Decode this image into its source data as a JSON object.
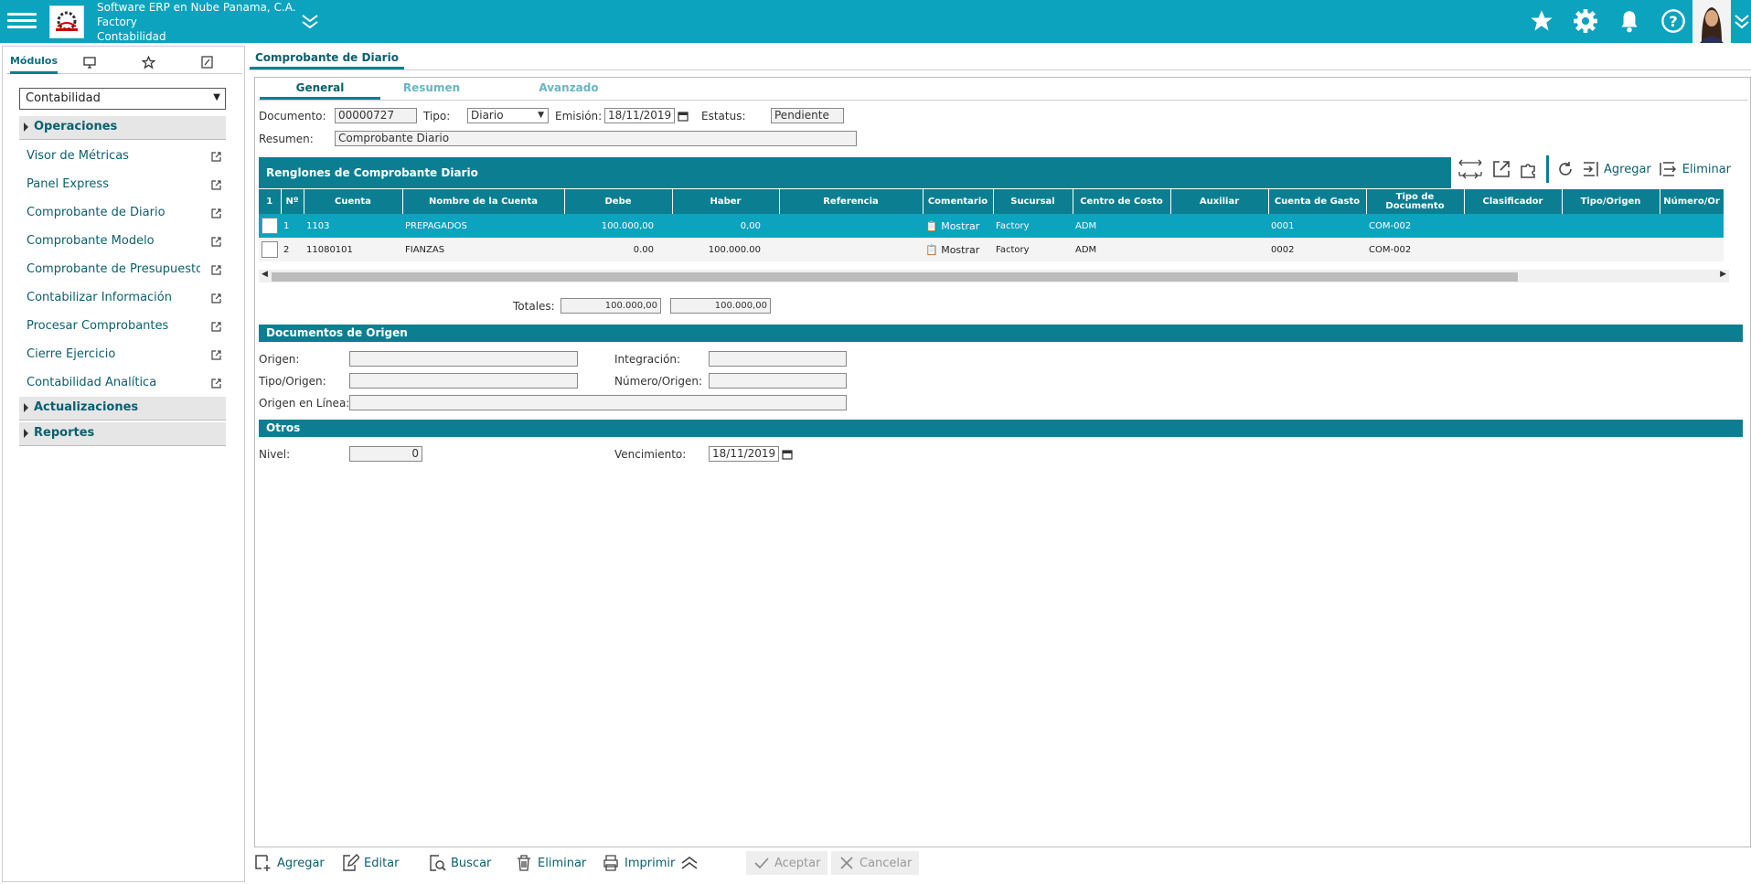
{
  "header": {
    "company": "Software ERP en Nube Panama, C.A.",
    "branch": "Factory",
    "module": "Contabilidad"
  },
  "left": {
    "tab_modules": "Módulos",
    "module_select": "Contabilidad",
    "sections": {
      "operaciones": "Operaciones",
      "actualizaciones": "Actualizaciones",
      "reportes": "Reportes"
    },
    "items": [
      "Visor de Métricas",
      "Panel Express",
      "Comprobante de Diario",
      "Comprobante Modelo",
      "Comprobante de Presupuesto",
      "Contabilizar Información",
      "Procesar Comprobantes",
      "Cierre Ejercicio",
      "Contabilidad Analítica"
    ]
  },
  "main": {
    "tab_title": "Comprobante de Diario",
    "subtabs": [
      "General",
      "Resumen",
      "Avanzado"
    ],
    "form": {
      "documento_label": "Documento:",
      "documento": "00000727",
      "tipo_label": "Tipo:",
      "tipo": "Diario",
      "emision_label": "Emisión:",
      "emision": "18/11/2019",
      "estatus_label": "Estatus:",
      "estatus": "Pendiente",
      "resumen_label": "Resumen:",
      "resumen": "Comprobante Diario"
    },
    "grid": {
      "title": "Renglones de Comprobante Diario",
      "add": "Agregar",
      "delete": "Eliminar",
      "columns": [
        "1",
        "Nº",
        "Cuenta",
        "Nombre de la Cuenta",
        "Debe",
        "Haber",
        "Referencia",
        "Comentario",
        "Sucursal",
        "Centro de Costo",
        "Auxiliar",
        "Cuenta de Gasto",
        "Tipo de Documento",
        "Clasificador",
        "Tipo/Origen",
        "Número/Or"
      ],
      "rows": [
        {
          "n": "1",
          "cuenta": "1103",
          "nombre": "PREPAGADOS",
          "debe": "100.000,00",
          "haber": "0,00",
          "comentario": "Mostrar",
          "sucursal": "Factory",
          "centro": "ADM",
          "gasto": "0001",
          "tipodoc": "COM-002"
        },
        {
          "n": "2",
          "cuenta": "11080101",
          "nombre": "FIANZAS",
          "debe": "0.00",
          "haber": "100.000.00",
          "comentario": "Mostrar",
          "sucursal": "Factory",
          "centro": "ADM",
          "gasto": "0002",
          "tipodoc": "COM-002"
        }
      ],
      "totales_label": "Totales:",
      "total_debe": "100.000,00",
      "total_haber": "100.000,00"
    },
    "origen": {
      "title": "Documentos de Origen",
      "origen_label": "Origen:",
      "integracion_label": "Integración:",
      "tipo_origen_label": "Tipo/Origen:",
      "numero_origen_label": "Número/Origen:",
      "origen_linea_label": "Origen en Línea:"
    },
    "otros": {
      "title": "Otros",
      "nivel_label": "Nivel:",
      "nivel": "0",
      "vencimiento_label": "Vencimiento:",
      "vencimiento": "18/11/2019"
    }
  },
  "footer": {
    "agregar": "Agregar",
    "editar": "Editar",
    "buscar": "Buscar",
    "eliminar": "Eliminar",
    "imprimir": "Imprimir",
    "aceptar": "Aceptar",
    "cancelar": "Cancelar"
  },
  "colors": {
    "accent": "#0ba3bd",
    "band": "#0b7f91",
    "text_link": "#0b5f6e"
  },
  "icons": [
    "menu-icon",
    "star-icon",
    "gear-icon",
    "bell-icon",
    "help-icon",
    "monitor-icon",
    "paperclip-icon",
    "external-link-icon",
    "calendar-icon",
    "refresh-icon",
    "puzzle-icon"
  ]
}
